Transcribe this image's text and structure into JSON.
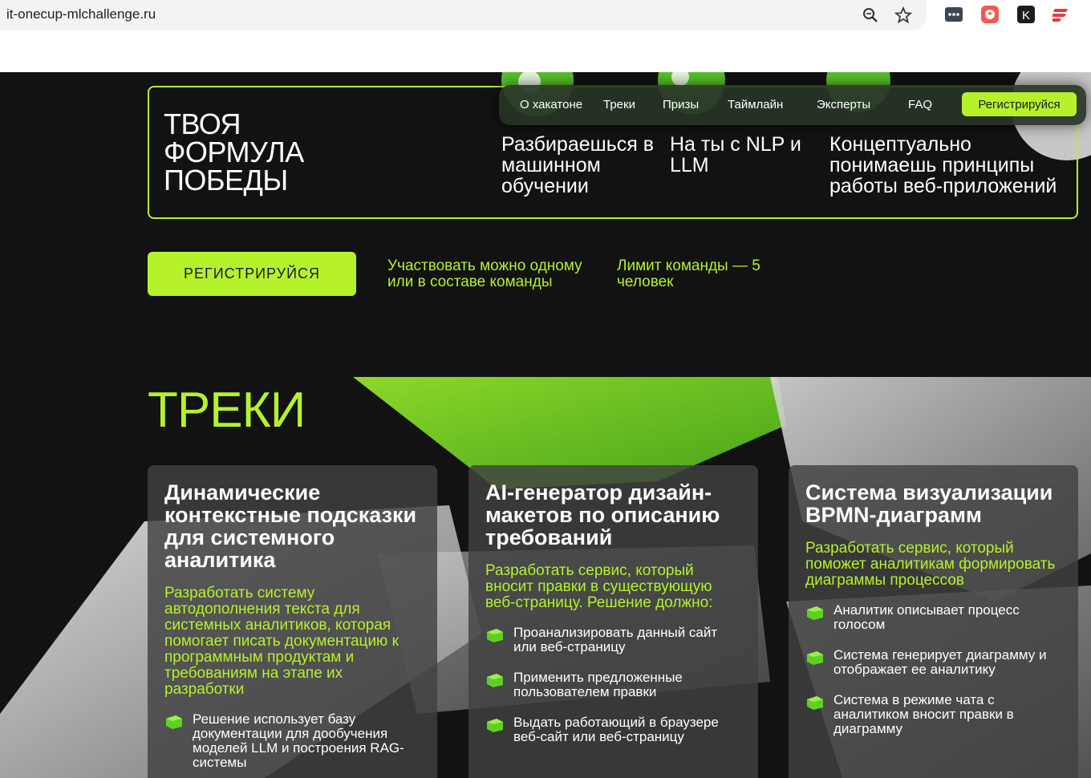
{
  "browser": {
    "url": "it-onecup-mlchallenge.ru",
    "icons": [
      "zoom-icon",
      "bookmark-star-icon",
      "extension-dots-icon",
      "extension-red-icon",
      "extension-k-icon",
      "extension-stack-icon"
    ]
  },
  "hero": {
    "title": "ТВОЯ ФОРМУЛА ПОБЕДЫ",
    "features": [
      "Разбираешься в машинном обучении",
      "На ты с NLP и LLM",
      "Концептуально понимаешь принципы работы веб-приложений"
    ]
  },
  "nav": {
    "items": [
      "О хакатоне",
      "Треки",
      "Призы",
      "Таймлайн",
      "Эксперты",
      "FAQ"
    ],
    "register": "Регистрируйся"
  },
  "cta": {
    "register": "РЕГИСТРИРУЙСЯ",
    "note1": "Участвовать можно одному или в составе команды",
    "note2": "Лимит команды — 5 человек"
  },
  "tracks": {
    "heading": "ТРЕКИ",
    "cards": [
      {
        "title": "Динамические контекстные подсказки для системного аналитика",
        "desc": "Разработать систему автодополнения текста для системных аналитиков, которая помогает писать документацию к программным продуктам и требованиям на этапе их разработки",
        "bullets": [
          "Решение использует базу документации для дообучения моделей LLM и построения RAG-системы"
        ]
      },
      {
        "title": "AI-генератор дизайн-макетов по описанию требований",
        "desc": "Разработать сервис, который вносит правки в существующую веб-страницу. Решение должно:",
        "bullets": [
          "Проанализировать данный сайт или веб-страницу",
          "Применить предложенные пользователем правки",
          "Выдать работающий в браузере веб-сайт или веб-страницу"
        ]
      },
      {
        "title": "Система визуализации BPMN-диаграмм",
        "desc": "Разработать сервис, который поможет аналитикам формировать диаграммы процессов",
        "bullets": [
          "Аналитик описывает процесс голосом",
          "Система генерирует диаграмму и отображает ее аналитику",
          "Система в режиме чата с аналитиком вносит правки в диаграмму"
        ]
      }
    ]
  },
  "colors": {
    "accent": "#b5f22c",
    "background": "#121212",
    "card": "#414141"
  }
}
